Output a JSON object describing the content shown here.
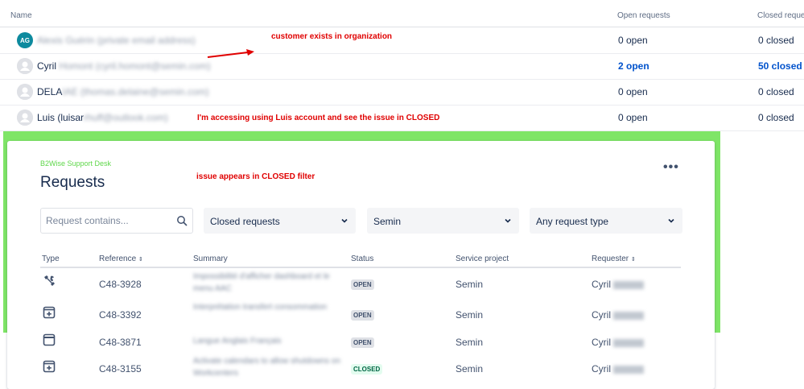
{
  "customers_table": {
    "headers": {
      "name": "Name",
      "open": "Open requests",
      "closed": "Closed reque"
    },
    "rows": [
      {
        "initials": "AG",
        "name_visible": "",
        "name_blurred": "Alexis Guérin (private email address)",
        "open": "0 open",
        "closed": "0 closed",
        "link": false,
        "avatar": "initials"
      },
      {
        "initials": "",
        "name_visible": "Cyril",
        "name_blurred": "Homont (cyril.homont@semin.com)",
        "open": "2 open",
        "closed": "50 closed",
        "link": true,
        "avatar": "generic"
      },
      {
        "initials": "",
        "name_visible": "DELA",
        "name_blurred": "IAE (thomas.delaine@semin.com)",
        "open": "0 open",
        "closed": "0 closed",
        "link": false,
        "avatar": "generic"
      },
      {
        "initials": "",
        "name_visible": "Luis (luisar",
        "name_blurred": "rhuff@outlook.com)",
        "open": "0 open",
        "closed": "0 closed",
        "link": false,
        "avatar": "generic"
      }
    ]
  },
  "annotations": {
    "customer_exists": "customer exists in organization",
    "accessing": "I'm accessing using Luis account and see the issue in CLOSED",
    "closed_filter": "issue appears in CLOSED filter",
    "color": "#e00000"
  },
  "portal": {
    "help_desk": "B2Wise Support Desk",
    "title": "Requests",
    "more_icon": "ellipsis-icon",
    "search_placeholder": "Request contains...",
    "filters": {
      "status": "Closed requests",
      "organization": "Semin",
      "request_type": "Any request type"
    },
    "columns": [
      "Type",
      "Reference",
      "Summary",
      "Status",
      "Service project",
      "Requester"
    ],
    "rows": [
      {
        "type_icon": "tools-icon",
        "ref": "C48-3928",
        "summary": "Impossibilité d'afficher dashboard et le menu AAC",
        "status": "OPEN",
        "project": "Semin",
        "requester": "Cyril"
      },
      {
        "type_icon": "plus-box-icon",
        "ref": "C48-3392",
        "summary": "Interprétation transfert consommation",
        "status": "OPEN",
        "project": "Semin",
        "requester": "Cyril"
      },
      {
        "type_icon": "window-icon",
        "ref": "C48-3871",
        "summary": "Langue Anglais Français",
        "status": "OPEN",
        "project": "Semin",
        "requester": "Cyril"
      },
      {
        "type_icon": "plus-box-icon",
        "ref": "C48-3155",
        "summary": "Activate calendars to allow shutdowns on Workcenters",
        "status": "CLOSED",
        "project": "Semin",
        "requester": "Cyril"
      }
    ],
    "accent_green": "#7fe567"
  }
}
